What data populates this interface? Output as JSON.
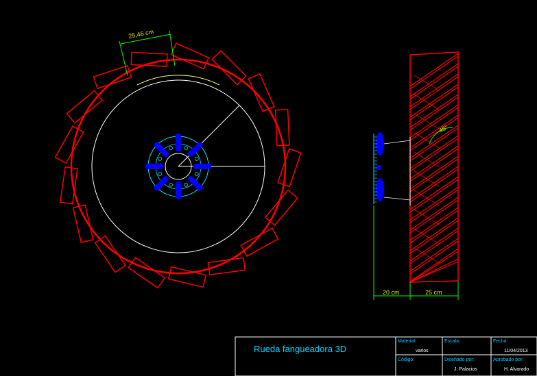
{
  "colors": {
    "background": "#000000",
    "paddle": "#ff0000",
    "rim": "#ffffff",
    "hub": "#0000ff",
    "hub_circle": "#00e5ff",
    "dimension": "#00ff00",
    "annotation_text": "#ffff00",
    "titleblock_label": "#00c8ff",
    "titleblock_value": "#ffffff"
  },
  "front_view": {
    "paddle_count": 17,
    "paddle_width_label": "25,46 cm"
  },
  "side_view": {
    "hub_width_label": "20 cm",
    "paddle_width_label": "25 cm",
    "angle_label": "45°"
  },
  "title_block": {
    "title": "Rueda fangueadora 3D",
    "material_label": "Material:",
    "material_value": "varios",
    "scale_label": "Escala:",
    "scale_value": "",
    "date_label": "Fecha:",
    "date_value": "11/04/2013",
    "code_label": "Código:",
    "code_value": "",
    "designed_label": "Diseñado por:",
    "designed_value": "J. Palacios",
    "approved_label": "Aprobado por:",
    "approved_value": "H. Alvarado"
  }
}
